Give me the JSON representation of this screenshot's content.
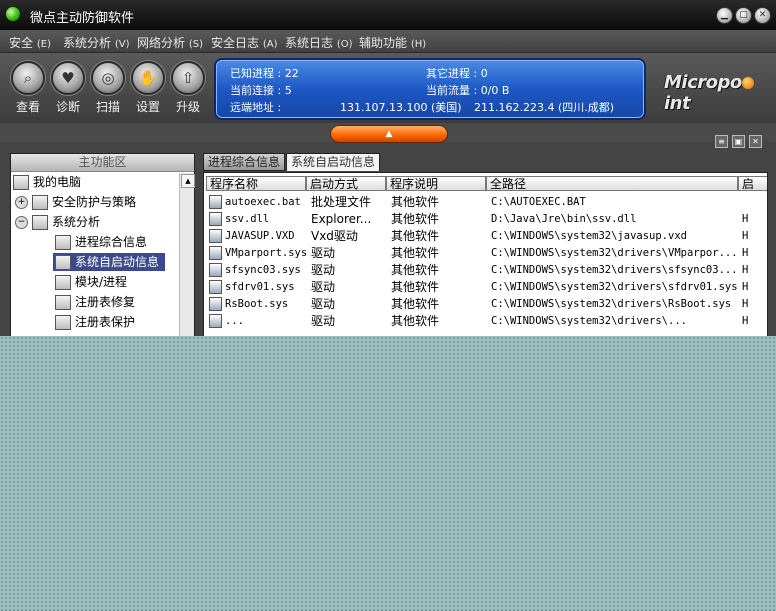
{
  "window": {
    "title": "微点主动防御软件",
    "controls": [
      "minimize",
      "restore",
      "close"
    ]
  },
  "menu": [
    {
      "label": "安全",
      "accel": "(E)"
    },
    {
      "label": "系统分析",
      "accel": "(V)"
    },
    {
      "label": "网络分析",
      "accel": "(S)"
    },
    {
      "label": "安全日志",
      "accel": "(A)"
    },
    {
      "label": "系统日志",
      "accel": "(O)"
    },
    {
      "label": "辅助功能",
      "accel": "(H)"
    }
  ],
  "toolbar": [
    {
      "label": "查看",
      "icon": "magnifier-icon"
    },
    {
      "label": "诊断",
      "icon": "heart-icon"
    },
    {
      "label": "扫描",
      "icon": "target-icon"
    },
    {
      "label": "设置",
      "icon": "hand-icon"
    },
    {
      "label": "升级",
      "icon": "upgrade-icon"
    }
  ],
  "info": {
    "known_process": "已知进程 : 22",
    "other_process": "其它进程 : 0",
    "current_connections": "当前连接 : 5",
    "current_traffic": "当前流量 : 0/0 B",
    "remote_label": "远端地址 :",
    "remote_addr_1": "131.107.13.100 (美国)",
    "remote_addr_2": "211.162.223.4 (四川.成都)"
  },
  "logo": {
    "text_before": "Micropo",
    "text_after": "int"
  },
  "left_panel": {
    "header": "主功能区",
    "items": [
      {
        "label": "我的电脑",
        "level": 0
      },
      {
        "label": "安全防护与策略",
        "level": 1,
        "expander": "+"
      },
      {
        "label": "系统分析",
        "level": 1,
        "expander": "-"
      },
      {
        "label": "进程综合信息",
        "level": 2
      },
      {
        "label": "系统自启动信息",
        "level": 2,
        "selected": true
      },
      {
        "label": "模块/进程",
        "level": 2
      },
      {
        "label": "注册表修复",
        "level": 2
      },
      {
        "label": "注册表保护",
        "level": 2
      }
    ]
  },
  "tabs": [
    {
      "label": "进程综合信息",
      "active": false
    },
    {
      "label": "系统自启动信息",
      "active": true
    }
  ],
  "table": {
    "columns": [
      "程序名称",
      "启动方式",
      "程序说明",
      "全路径",
      "启"
    ],
    "rows": [
      {
        "name": "autoexec.bat",
        "start": "批处理文件",
        "desc": "其他软件",
        "path": "C:\\AUTOEXEC.BAT",
        "extra": ""
      },
      {
        "name": "ssv.dll",
        "start": "Explorer...",
        "desc": "其他软件",
        "path": "D:\\Java\\Jre\\bin\\ssv.dll",
        "extra": "H"
      },
      {
        "name": "JAVASUP.VXD",
        "start": "Vxd驱动",
        "desc": "其他软件",
        "path": "C:\\WINDOWS\\system32\\javasup.vxd",
        "extra": "H"
      },
      {
        "name": "VMparport.sys",
        "start": "驱动",
        "desc": "其他软件",
        "path": "C:\\WINDOWS\\system32\\drivers\\VMparpor...",
        "extra": "H"
      },
      {
        "name": "sfsync03.sys",
        "start": "驱动",
        "desc": "其他软件",
        "path": "C:\\WINDOWS\\system32\\drivers\\sfsync03...",
        "extra": "H"
      },
      {
        "name": "sfdrv01.sys",
        "start": "驱动",
        "desc": "其他软件",
        "path": "C:\\WINDOWS\\system32\\drivers\\sfdrv01.sys",
        "extra": "H"
      },
      {
        "name": "RsBoot.sys",
        "start": "驱动",
        "desc": "其他软件",
        "path": "C:\\WINDOWS\\system32\\drivers\\RsBoot.sys",
        "extra": "H"
      },
      {
        "name": "...",
        "start": "驱动",
        "desc": "其他软件",
        "path": "C:\\WINDOWS\\system32\\drivers\\...",
        "extra": "H"
      }
    ]
  }
}
